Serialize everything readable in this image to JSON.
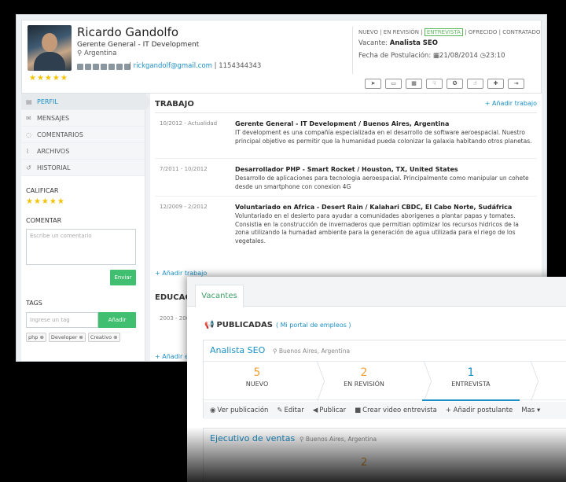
{
  "candidate": {
    "name": "Ricardo Gandolfo",
    "role": "Gerente General - IT Development",
    "location": "Argentina",
    "stars": "★★★★★",
    "email": "rickgandolf@gmail.com",
    "phone": "1154344343"
  },
  "stages_line": {
    "before": "NUEVO | EN REVISIÓN | ",
    "active": "ENTREVISTA",
    "after": " | OFRECIDO | CONTRATADO"
  },
  "vacancy": {
    "label": "Vacante:",
    "value": "Analista SEO"
  },
  "application": {
    "label": "Fecha de Postulación:",
    "date": "21/08/2014",
    "time": "23:10"
  },
  "toolbar_icons": [
    "paper-plane-icon",
    "video-icon",
    "calendar-icon",
    "thumbs-down-icon",
    "medal-icon",
    "thumbs-up-icon",
    "add-user-icon",
    "export-icon"
  ],
  "sidebar": {
    "nav": [
      {
        "label": "PERFIL",
        "icon": "id-card-icon"
      },
      {
        "label": "MENSAJES",
        "icon": "envelope-icon"
      },
      {
        "label": "COMENTARIOS",
        "icon": "comment-icon"
      },
      {
        "label": "ARCHIVOS",
        "icon": "paperclip-icon"
      },
      {
        "label": "HISTORIAL",
        "icon": "history-icon"
      }
    ],
    "rate_label": "CALIFICAR",
    "rate_stars": "★★★★★",
    "comment_label": "COMENTAR",
    "comment_placeholder": "Escribe un comentario",
    "send_label": "Enviar",
    "tags_label": "TAGS",
    "tag_placeholder": "Ingrese un tag",
    "add_label": "Añadir",
    "tags": [
      "php ⊗",
      "Developer ⊗",
      "Creativo ⊗"
    ]
  },
  "work": {
    "title": "TRABAJO",
    "add_label": "+ Añadir trabajo",
    "jobs": [
      {
        "dates": "10/2012 - Actualidad",
        "title": "Gerente General - IT Development / Buenos Aires, Argentina",
        "desc": "IT development es una compañía especializada en el desarrollo de software aeroespacial. Nuestro principal objetivo es permitir que la humanidad pueda colonizar la galaxia habitando otros planetas."
      },
      {
        "dates": "7/2011 - 10/2012",
        "title": "Desarrollador PHP - Smart Rocket / Houston, TX, United States",
        "desc": "Desarrollo de aplicaciones para tecnologia aeroespacial. Principalmente como manipular un cohete desde un smartphone con conexion 4G"
      },
      {
        "dates": "12/2009 - 2/2012",
        "title": "Voluntariado en Africa - Desert Rain / Kalahari CBDC, El Cabo Norte, Sudáfrica",
        "desc": "Voluntariado en el desierto para ayudar a comunidades aborigenes a plantar papas y tomates. Consistia en la construcción de invernaderos que permitian optimizar los recursos hidricos de la zona utilizando la humadad ambiente para la generación de agua utilizada para el riego de los vegetales."
      }
    ],
    "add_label_bottom": "+ Añadir trabajo"
  },
  "education": {
    "title": "EDUCAC",
    "dates": "2003 - 200",
    "add_label": "+ Añadir e"
  },
  "vacantes": {
    "tab": "Vacantes",
    "section_title": "PUBLICADAS",
    "portal_link": "( Mi portal de empleos )",
    "jobs": [
      {
        "title": "Analista SEO",
        "location": "Buenos Aires, Argentina",
        "stages": [
          {
            "count": "5",
            "label": "NUEVO"
          },
          {
            "count": "2",
            "label": "EN REVISIÓN"
          },
          {
            "count": "1",
            "label": "ENTREVISTA"
          }
        ],
        "actions": [
          "Ver publicación",
          "Editar",
          "Publicar",
          "Crear video entrevista",
          "+ Añadir postulante",
          "Mas ▾"
        ]
      },
      {
        "title": "Ejecutivo de ventas",
        "location": "Buenos Aires, Argentina",
        "first_count": "2"
      }
    ]
  }
}
